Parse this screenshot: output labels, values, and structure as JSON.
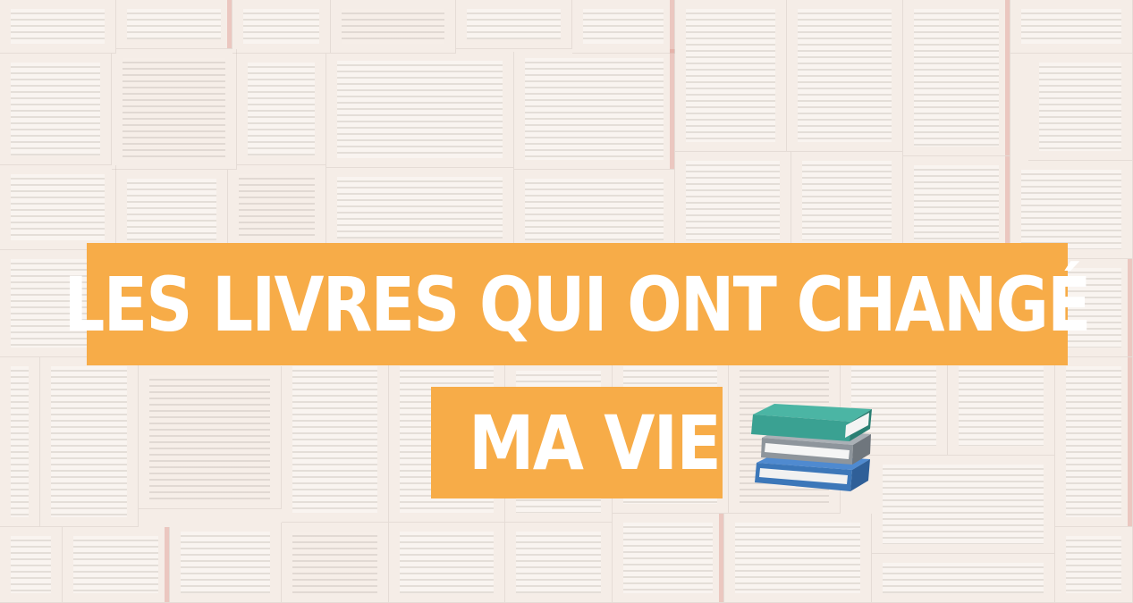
{
  "title": {
    "line1": "LES LIVRES QUI ONT  CHANGÉ",
    "line2": "MA VIE"
  },
  "colors": {
    "banner": "#f7ac48",
    "text": "#ffffff",
    "book_teal": "#3aa192",
    "book_gray": "#8e959c",
    "book_blue": "#3c77b9"
  },
  "icons": {
    "books": "stacked-books-icon"
  }
}
